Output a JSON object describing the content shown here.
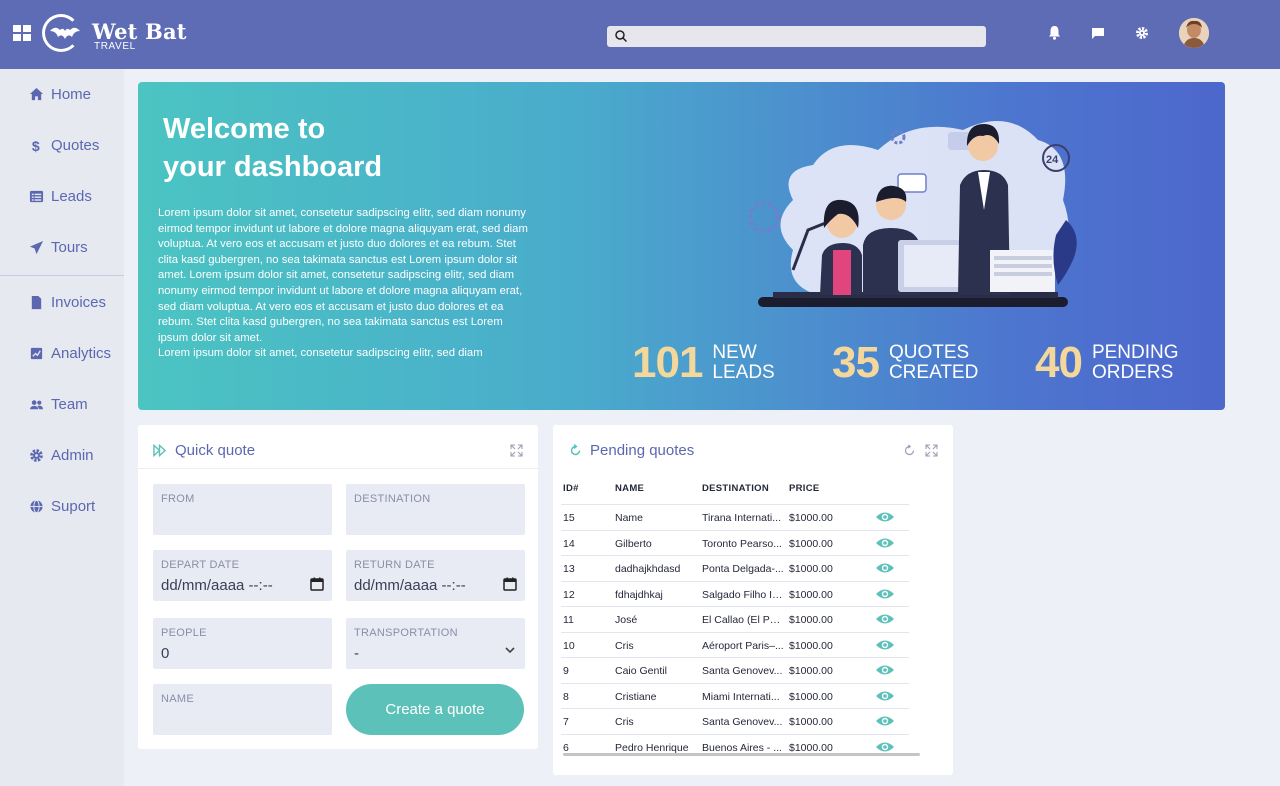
{
  "app": {
    "brand": "Wet Bat",
    "brand_sub": "TRAVEL"
  },
  "search": {
    "placeholder": "",
    "value": ""
  },
  "colors": {
    "primary": "#5e6cb5",
    "accent": "#5cc1b8",
    "stat_number": "#f4d79b"
  },
  "sidebar": {
    "items": [
      {
        "label": "Home",
        "icon": "home-icon"
      },
      {
        "label": "Quotes",
        "icon": "dollar-icon"
      },
      {
        "label": "Leads",
        "icon": "list-icon"
      },
      {
        "label": "Tours",
        "icon": "send-icon"
      },
      {
        "label": "Invoices",
        "icon": "file-icon"
      },
      {
        "label": "Analytics",
        "icon": "analytics-icon"
      },
      {
        "label": "Team",
        "icon": "team-icon"
      },
      {
        "label": "Admin",
        "icon": "gear-icon"
      },
      {
        "label": "Suport",
        "icon": "globe-icon"
      }
    ]
  },
  "hero": {
    "title_line1": "Welcome to",
    "title_line2": "your dashboard",
    "text": "Lorem ipsum dolor sit amet, consetetur sadipscing elitr, sed diam nonumy eirmod tempor invidunt ut labore et dolore magna aliquyam erat, sed diam voluptua. At vero eos et accusam et justo duo dolores et ea rebum. Stet clita kasd gubergren, no sea takimata sanctus est Lorem ipsum dolor sit amet. Lorem ipsum dolor sit amet, consetetur sadipscing elitr, sed diam nonumy eirmod tempor invidunt ut labore et dolore magna aliquyam erat, sed diam voluptua. At vero eos et accusam et justo duo dolores et ea rebum. Stet clita kasd gubergren, no sea takimata sanctus est Lorem ipsum dolor sit amet.",
    "text2": "Lorem ipsum dolor sit amet, consetetur sadipscing elitr, sed diam",
    "stats": [
      {
        "value": "101",
        "line1": "NEW",
        "line2": "LEADS"
      },
      {
        "value": "35",
        "line1": "QUOTES",
        "line2": "CREATED"
      },
      {
        "value": "40",
        "line1": "PENDING",
        "line2": "ORDERS"
      }
    ]
  },
  "quick_quote": {
    "title": "Quick quote",
    "from_label": "FROM",
    "from_value": "",
    "destination_label": "DESTINATION",
    "destination_value": "",
    "depart_label": "DEPART DATE",
    "depart_value": "dd/mm/aaaa --:--",
    "return_label": "RETURN DATE",
    "return_value": "dd/mm/aaaa --:--",
    "people_label": "PEOPLE",
    "people_value": "0",
    "transport_label": "TRANSPORTATION",
    "transport_value": "-",
    "name_label": "NAME",
    "name_value": "",
    "submit_label": "Create a quote"
  },
  "pending": {
    "title": "Pending quotes",
    "headers": {
      "id": "ID#",
      "name": "NAME",
      "destination": "DESTINATION",
      "price": "PRICE"
    },
    "rows": [
      {
        "id": "15",
        "name": "Name",
        "destination": "Tirana Internati...",
        "price": "$1000.00"
      },
      {
        "id": "14",
        "name": "Gilberto",
        "destination": "Toronto Pearso...",
        "price": "$1000.00"
      },
      {
        "id": "13",
        "name": "dadhajkhdasd",
        "destination": "Ponta Delgada-...",
        "price": "$1000.00"
      },
      {
        "id": "12",
        "name": "fdhajdhkaj",
        "destination": "Salgado Filho In...",
        "price": "$1000.00"
      },
      {
        "id": "11",
        "name": "José",
        "destination": "El Callao (El Per...",
        "price": "$1000.00"
      },
      {
        "id": "10",
        "name": "Cris",
        "destination": "Aéroport Paris–...",
        "price": "$1000.00"
      },
      {
        "id": "9",
        "name": "Caio Gentil",
        "destination": "Santa Genovev...",
        "price": "$1000.00"
      },
      {
        "id": "8",
        "name": "Cristiane",
        "destination": "Miami Internati...",
        "price": "$1000.00"
      },
      {
        "id": "7",
        "name": "Cris",
        "destination": "Santa Genovev...",
        "price": "$1000.00"
      },
      {
        "id": "6",
        "name": "Pedro Henrique",
        "destination": "Buenos Aires - ...",
        "price": "$1000.00"
      }
    ]
  }
}
